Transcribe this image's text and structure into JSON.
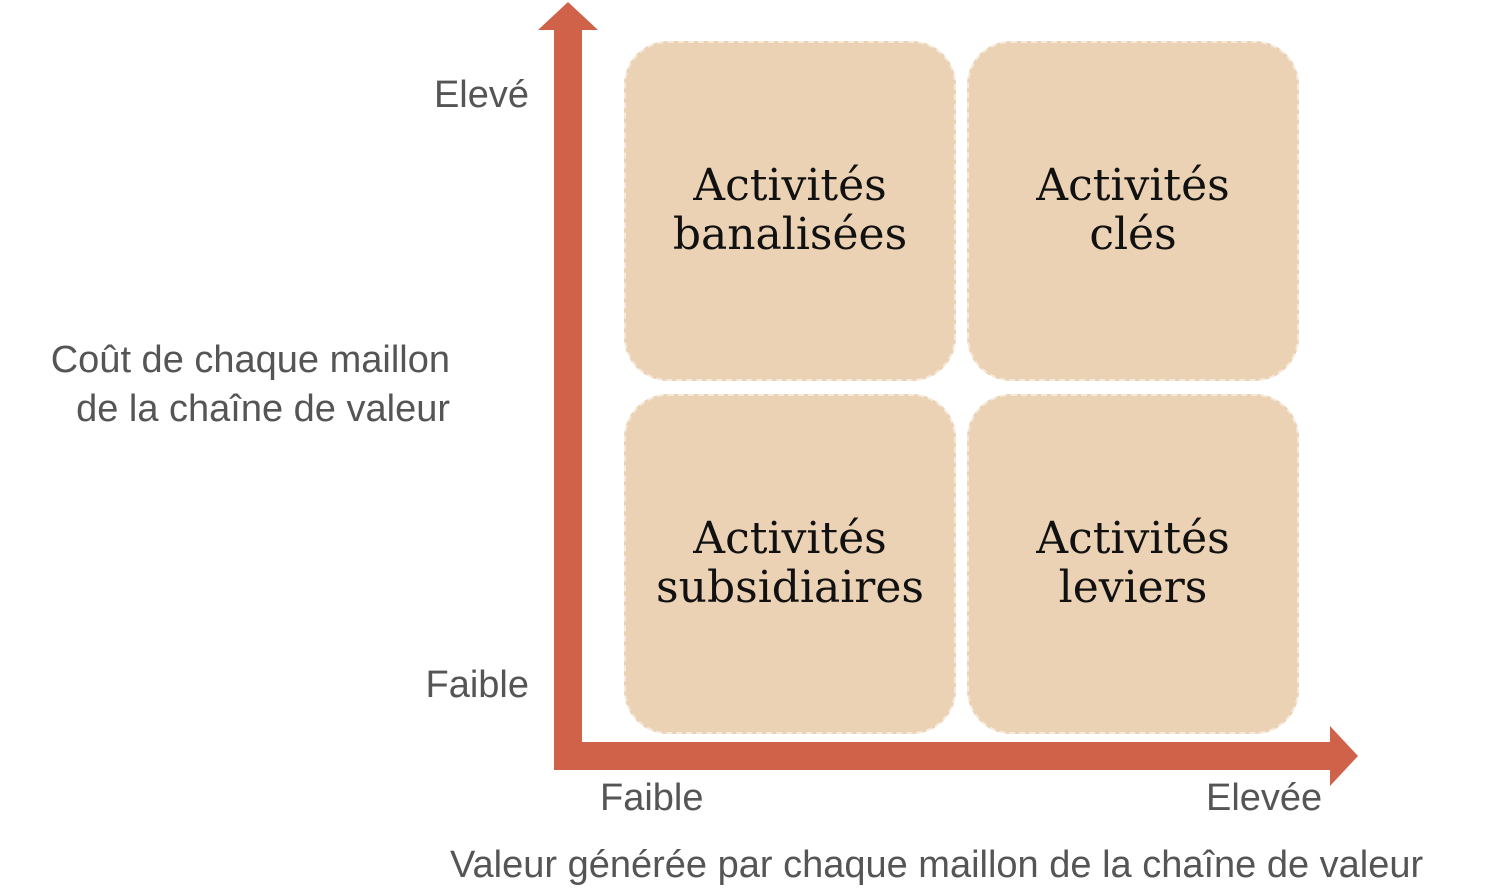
{
  "colors": {
    "axis": "#d0624a",
    "quadrant_fill": "#ecd2b4",
    "label_text": "#555555",
    "quadrant_text": "#111111"
  },
  "y_axis": {
    "title": "Coût de chaque maillon\nde la chaîne de valeur",
    "high_label": "Elevé",
    "low_label": "Faible"
  },
  "x_axis": {
    "title": "Valeur générée par chaque maillon de la chaîne de valeur",
    "low_label": "Faible",
    "high_label": "Elevée"
  },
  "quadrants": [
    {
      "position": "top-left",
      "label": "Activités\nbanalisées"
    },
    {
      "position": "top-right",
      "label": "Activités\nclés"
    },
    {
      "position": "bottom-left",
      "label": "Activités\nsubsidiaires"
    },
    {
      "position": "bottom-right",
      "label": "Activités\nleviers"
    }
  ]
}
